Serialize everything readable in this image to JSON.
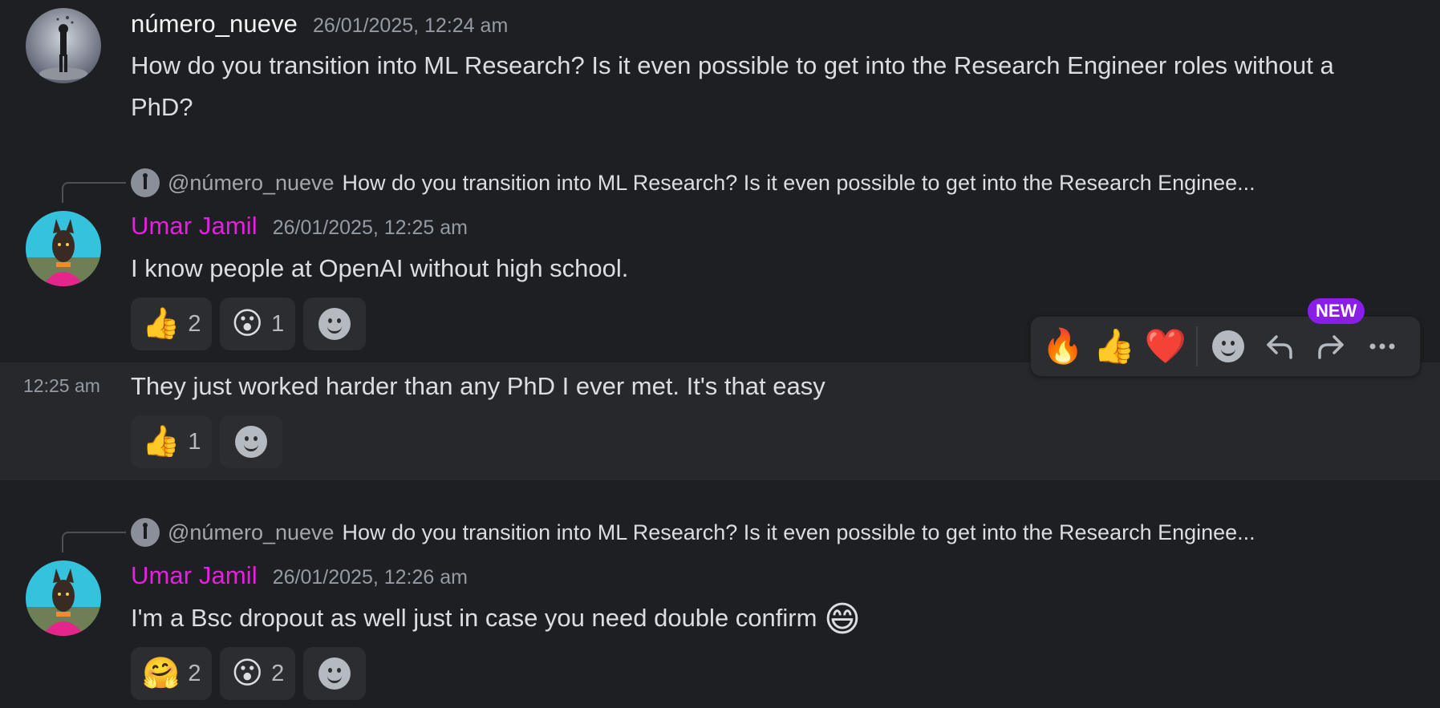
{
  "messages": [
    {
      "username": "número_nueve",
      "timestamp": "26/01/2025, 12:24 am",
      "text": "How do you transition into ML Research? Is it even possible to get into the Research Engineer roles without a PhD?"
    },
    {
      "reply": {
        "mention": "@número_nueve",
        "text": "How do you transition into ML Research? Is it even possible to get into the Research Enginee..."
      },
      "username": "Umar Jamil",
      "timestamp": "26/01/2025, 12:25 am",
      "text": "I know people at OpenAI without high school.",
      "reactions": [
        {
          "emoji": "👍",
          "count": "2"
        },
        {
          "emoji": "😮",
          "count": "1"
        }
      ]
    },
    {
      "side_time": "12:25 am",
      "text": "They just worked harder than any PhD I ever met. It's that easy",
      "reactions": [
        {
          "emoji": "👍",
          "count": "1"
        }
      ]
    },
    {
      "reply": {
        "mention": "@número_nueve",
        "text": "How do you transition into ML Research? Is it even possible to get into the Research Enginee..."
      },
      "username": "Umar Jamil",
      "timestamp": "26/01/2025, 12:26 am",
      "text": "I'm a Bsc dropout as well just in case you need double confirm",
      "trailing_emoji": "😄",
      "reactions": [
        {
          "emoji": "🤗",
          "count": "2"
        },
        {
          "emoji": "😮",
          "count": "2"
        }
      ]
    }
  ],
  "toolbar": {
    "quick_reactions": [
      "🔥",
      "👍",
      "❤️"
    ],
    "add_reaction_icon": "add-reaction-icon",
    "reply_icon": "↰",
    "forward_icon": "↱",
    "more_icon": "⋯",
    "new_badge": "NEW"
  },
  "colors": {
    "background": "#1e1f22",
    "hover_row": "#27282c",
    "username_pink": "#e91ee0",
    "new_badge": "#8b1de9"
  }
}
